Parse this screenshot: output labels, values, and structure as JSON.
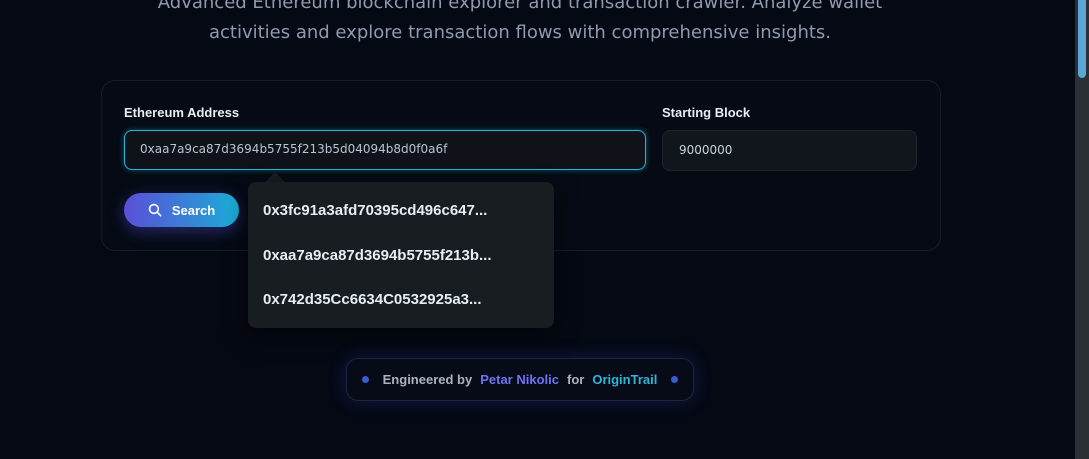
{
  "hero": {
    "subtitle_line1": "Advanced Ethereum blockchain explorer and transaction crawler. Analyze wallet",
    "subtitle_line2": "activities and explore transaction flows with comprehensive insights."
  },
  "form": {
    "address_label": "Ethereum Address",
    "address_value": "0xaa7a9ca87d3694b5755f213b5d04094b8d0f0a6f",
    "block_label": "Starting Block",
    "block_value": "9000000",
    "search_label": "Search"
  },
  "suggestions": [
    {
      "label": "0x3fc91a3afd70395cd496c647..."
    },
    {
      "label": "0xaa7a9ca87d3694b5755f213b..."
    },
    {
      "label": "0x742d35Cc6634C0532925a3..."
    }
  ],
  "footer": {
    "prefix": "Engineered by",
    "author": "Petar Nikolic",
    "joiner": "for",
    "org": "OriginTrail"
  },
  "colors": {
    "background": "#050914",
    "accent_cyan": "#20b8d3",
    "accent_purple": "#5b4fd9"
  },
  "icons": {
    "search": "search-icon"
  }
}
